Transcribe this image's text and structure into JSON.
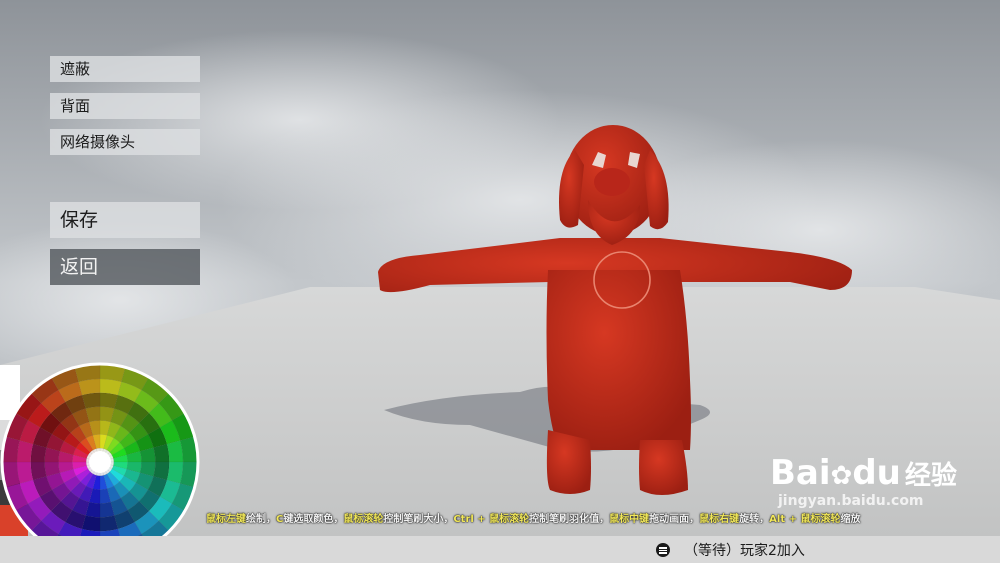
{
  "menu": {
    "mask": "遮蔽",
    "back_face": "背面",
    "webcam": "网络摄像头",
    "save": "保存",
    "return": "返回"
  },
  "hint": {
    "parts": [
      {
        "text": "鼠标左键",
        "key": true
      },
      {
        "text": "绘制，",
        "key": false
      },
      {
        "text": "C",
        "key": true
      },
      {
        "text": "键选取颜色，",
        "key": false
      },
      {
        "text": "鼠标滚轮",
        "key": true
      },
      {
        "text": "控制笔刷大小，",
        "key": false
      },
      {
        "text": "Ctrl + 鼠标滚轮",
        "key": true
      },
      {
        "text": "控制笔刷羽化值，",
        "key": false
      },
      {
        "text": "鼠标中键",
        "key": true
      },
      {
        "text": "拖动画面，",
        "key": false
      },
      {
        "text": "鼠标右键",
        "key": true
      },
      {
        "text": "旋转，",
        "key": false
      },
      {
        "text": "Alt + 鼠标滚轮",
        "key": true
      },
      {
        "text": "缩放",
        "key": false
      }
    ]
  },
  "status": {
    "text": "（等待）玩家2加入"
  },
  "watermark": {
    "brand": "Bai",
    "brand2": "du",
    "cn": "经验",
    "url": "jingyan.baidu.com"
  },
  "colors": {
    "current_color": "#d9412a",
    "model": "#c42a1a"
  }
}
